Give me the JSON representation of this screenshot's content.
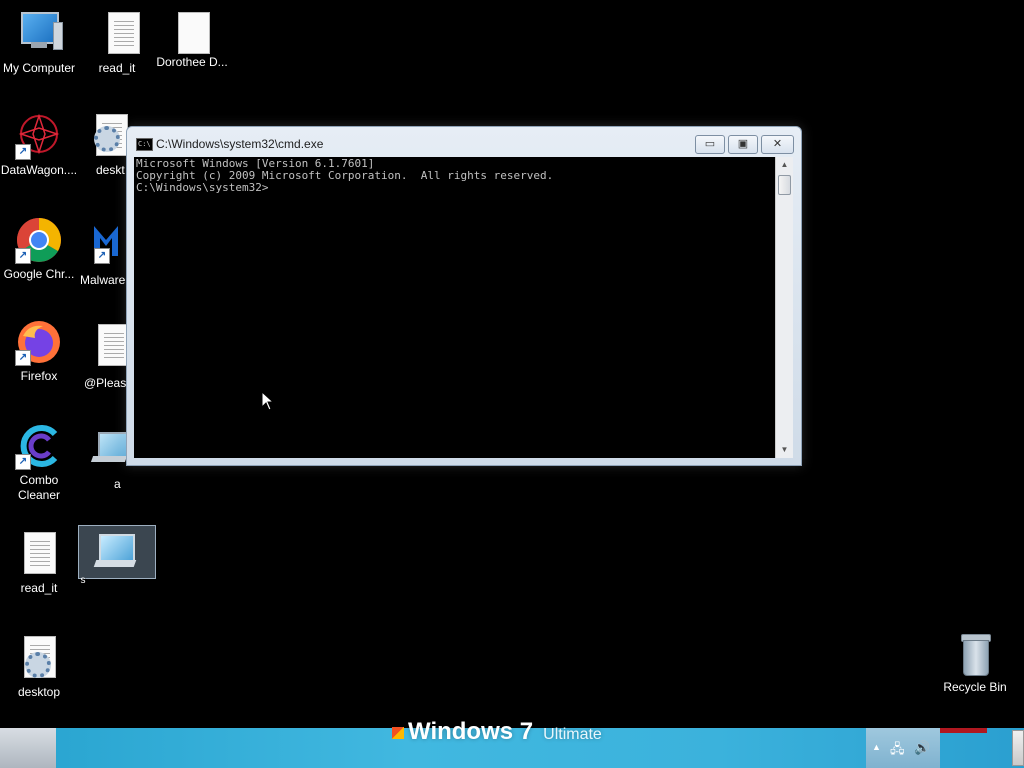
{
  "desktop": {
    "icons": [
      {
        "label": "My Computer"
      },
      {
        "label": "read_it"
      },
      {
        "label": "Dorothee D..."
      },
      {
        "label": "DataWagon...."
      },
      {
        "label": "deskt"
      },
      {
        "label": "Google Chr..."
      },
      {
        "label": "Malware"
      },
      {
        "label": "Firefox"
      },
      {
        "label": "@Please"
      },
      {
        "label": "Combo\nCleaner"
      },
      {
        "label": "a"
      },
      {
        "label": "read_it"
      },
      {
        "label": "s"
      },
      {
        "label": "desktop"
      },
      {
        "label": "Recycle Bin"
      }
    ]
  },
  "cmd_window": {
    "title": "C:\\Windows\\system32\\cmd.exe",
    "icon_text": "C:\\",
    "buttons": {
      "minimize": "▭",
      "maximize": "▣",
      "close": "✕"
    },
    "lines": [
      "Microsoft Windows [Version 6.1.7601]",
      "Copyright (c) 2009 Microsoft Corporation.  All rights reserved.",
      "",
      "C:\\Windows\\system32>"
    ]
  },
  "taskbar": {
    "brand_text": "Windows",
    "brand_version": "7",
    "brand_edition": "Ultimate",
    "tray": {
      "chevron": "▲",
      "network": "🖧",
      "volume": "🔊"
    }
  }
}
